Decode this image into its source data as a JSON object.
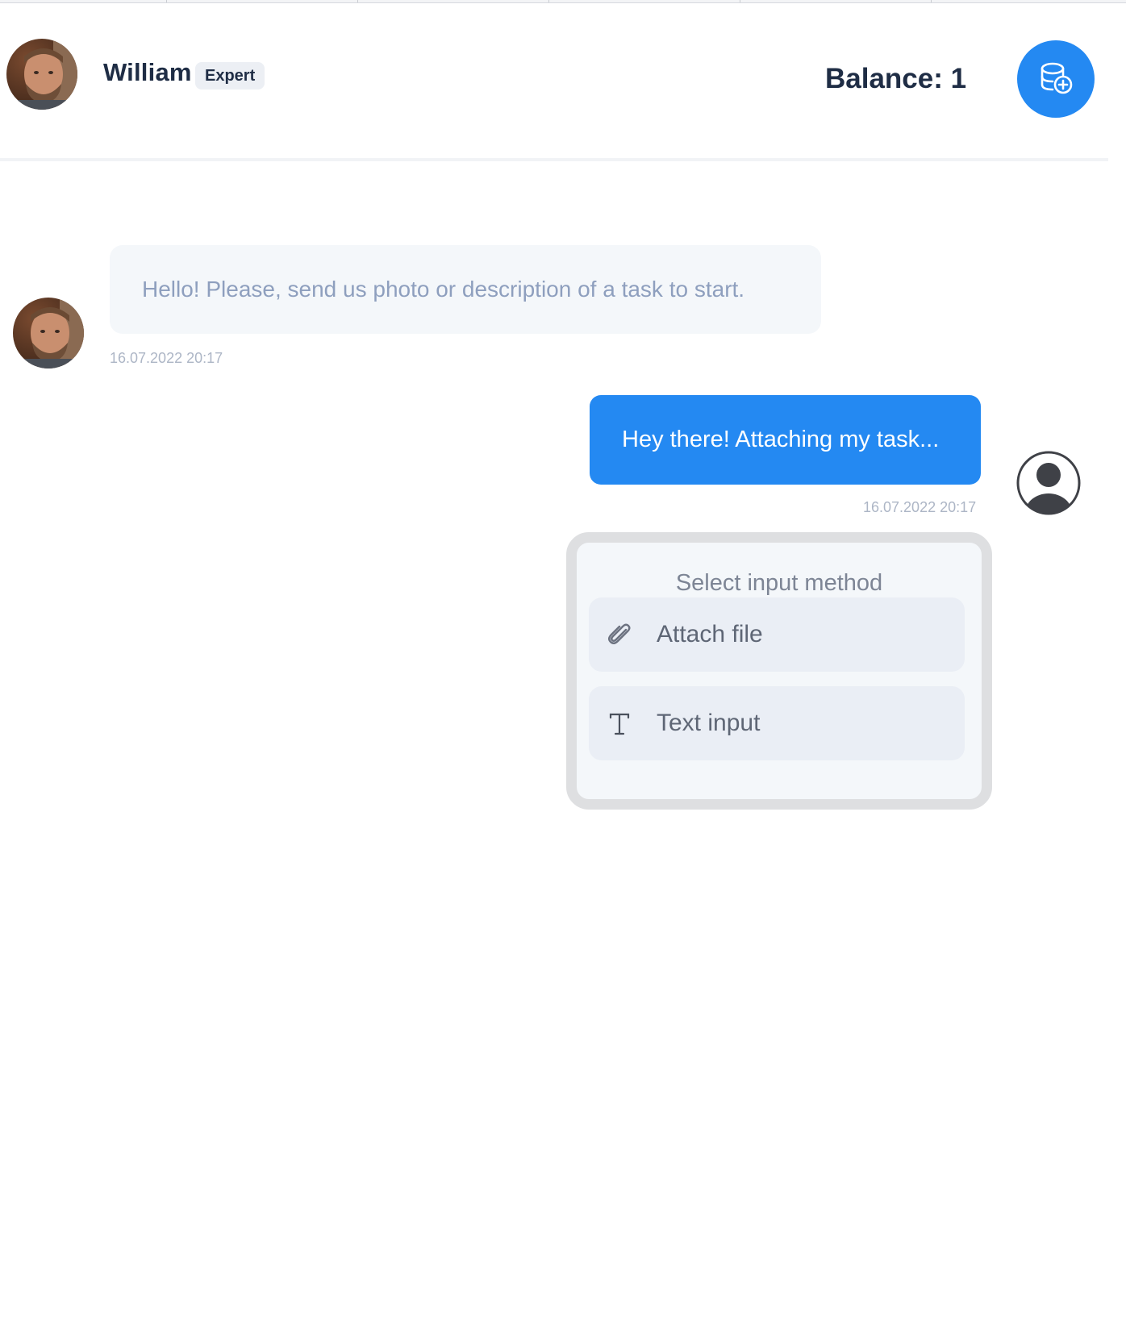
{
  "header": {
    "expert_name": "William",
    "expert_badge": "Expert",
    "balance_text": "Balance: 1"
  },
  "messages": [
    {
      "sender": "expert",
      "text": "Hello! Please, send us photo or description of a task to start.",
      "time": "16.07.2022 20:17"
    },
    {
      "sender": "user",
      "text": "Hey there! Attaching my task...",
      "time": "16.07.2022 20:17"
    }
  ],
  "input_picker": {
    "title": "Select input method",
    "options": [
      {
        "label": "Attach file",
        "icon": "paperclip-icon"
      },
      {
        "label": "Text input",
        "icon": "text-t-icon"
      }
    ]
  },
  "colors": {
    "accent": "#2489f2",
    "text_dark": "#1f2d45",
    "bubble_bg": "#f4f7fa",
    "muted_text": "#8e9fbe"
  }
}
